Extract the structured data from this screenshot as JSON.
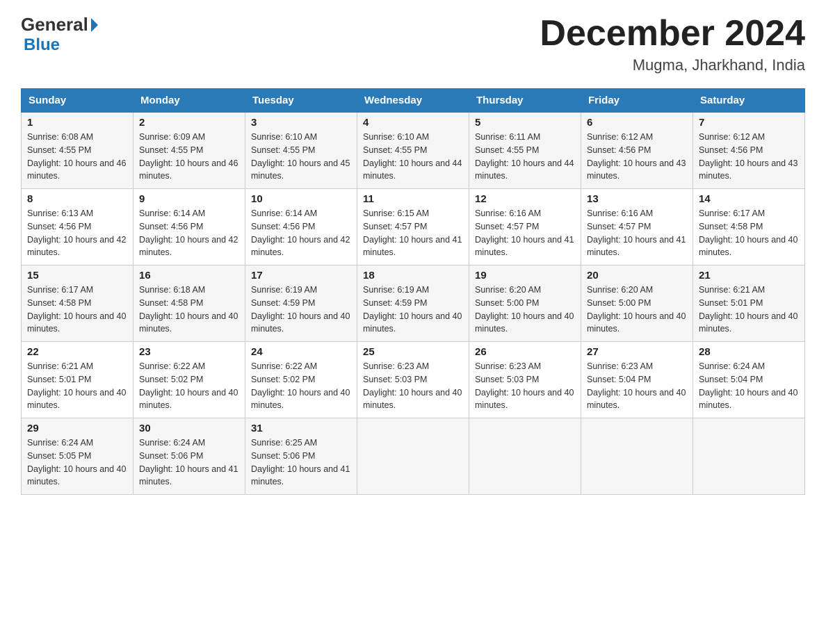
{
  "header": {
    "logo_general": "General",
    "logo_blue": "Blue",
    "month_title": "December 2024",
    "location": "Mugma, Jharkhand, India"
  },
  "days_of_week": [
    "Sunday",
    "Monday",
    "Tuesday",
    "Wednesday",
    "Thursday",
    "Friday",
    "Saturday"
  ],
  "weeks": [
    [
      {
        "day": "1",
        "sunrise": "6:08 AM",
        "sunset": "4:55 PM",
        "daylight": "10 hours and 46 minutes."
      },
      {
        "day": "2",
        "sunrise": "6:09 AM",
        "sunset": "4:55 PM",
        "daylight": "10 hours and 46 minutes."
      },
      {
        "day": "3",
        "sunrise": "6:10 AM",
        "sunset": "4:55 PM",
        "daylight": "10 hours and 45 minutes."
      },
      {
        "day": "4",
        "sunrise": "6:10 AM",
        "sunset": "4:55 PM",
        "daylight": "10 hours and 44 minutes."
      },
      {
        "day": "5",
        "sunrise": "6:11 AM",
        "sunset": "4:55 PM",
        "daylight": "10 hours and 44 minutes."
      },
      {
        "day": "6",
        "sunrise": "6:12 AM",
        "sunset": "4:56 PM",
        "daylight": "10 hours and 43 minutes."
      },
      {
        "day": "7",
        "sunrise": "6:12 AM",
        "sunset": "4:56 PM",
        "daylight": "10 hours and 43 minutes."
      }
    ],
    [
      {
        "day": "8",
        "sunrise": "6:13 AM",
        "sunset": "4:56 PM",
        "daylight": "10 hours and 42 minutes."
      },
      {
        "day": "9",
        "sunrise": "6:14 AM",
        "sunset": "4:56 PM",
        "daylight": "10 hours and 42 minutes."
      },
      {
        "day": "10",
        "sunrise": "6:14 AM",
        "sunset": "4:56 PM",
        "daylight": "10 hours and 42 minutes."
      },
      {
        "day": "11",
        "sunrise": "6:15 AM",
        "sunset": "4:57 PM",
        "daylight": "10 hours and 41 minutes."
      },
      {
        "day": "12",
        "sunrise": "6:16 AM",
        "sunset": "4:57 PM",
        "daylight": "10 hours and 41 minutes."
      },
      {
        "day": "13",
        "sunrise": "6:16 AM",
        "sunset": "4:57 PM",
        "daylight": "10 hours and 41 minutes."
      },
      {
        "day": "14",
        "sunrise": "6:17 AM",
        "sunset": "4:58 PM",
        "daylight": "10 hours and 40 minutes."
      }
    ],
    [
      {
        "day": "15",
        "sunrise": "6:17 AM",
        "sunset": "4:58 PM",
        "daylight": "10 hours and 40 minutes."
      },
      {
        "day": "16",
        "sunrise": "6:18 AM",
        "sunset": "4:58 PM",
        "daylight": "10 hours and 40 minutes."
      },
      {
        "day": "17",
        "sunrise": "6:19 AM",
        "sunset": "4:59 PM",
        "daylight": "10 hours and 40 minutes."
      },
      {
        "day": "18",
        "sunrise": "6:19 AM",
        "sunset": "4:59 PM",
        "daylight": "10 hours and 40 minutes."
      },
      {
        "day": "19",
        "sunrise": "6:20 AM",
        "sunset": "5:00 PM",
        "daylight": "10 hours and 40 minutes."
      },
      {
        "day": "20",
        "sunrise": "6:20 AM",
        "sunset": "5:00 PM",
        "daylight": "10 hours and 40 minutes."
      },
      {
        "day": "21",
        "sunrise": "6:21 AM",
        "sunset": "5:01 PM",
        "daylight": "10 hours and 40 minutes."
      }
    ],
    [
      {
        "day": "22",
        "sunrise": "6:21 AM",
        "sunset": "5:01 PM",
        "daylight": "10 hours and 40 minutes."
      },
      {
        "day": "23",
        "sunrise": "6:22 AM",
        "sunset": "5:02 PM",
        "daylight": "10 hours and 40 minutes."
      },
      {
        "day": "24",
        "sunrise": "6:22 AM",
        "sunset": "5:02 PM",
        "daylight": "10 hours and 40 minutes."
      },
      {
        "day": "25",
        "sunrise": "6:23 AM",
        "sunset": "5:03 PM",
        "daylight": "10 hours and 40 minutes."
      },
      {
        "day": "26",
        "sunrise": "6:23 AM",
        "sunset": "5:03 PM",
        "daylight": "10 hours and 40 minutes."
      },
      {
        "day": "27",
        "sunrise": "6:23 AM",
        "sunset": "5:04 PM",
        "daylight": "10 hours and 40 minutes."
      },
      {
        "day": "28",
        "sunrise": "6:24 AM",
        "sunset": "5:04 PM",
        "daylight": "10 hours and 40 minutes."
      }
    ],
    [
      {
        "day": "29",
        "sunrise": "6:24 AM",
        "sunset": "5:05 PM",
        "daylight": "10 hours and 40 minutes."
      },
      {
        "day": "30",
        "sunrise": "6:24 AM",
        "sunset": "5:06 PM",
        "daylight": "10 hours and 41 minutes."
      },
      {
        "day": "31",
        "sunrise": "6:25 AM",
        "sunset": "5:06 PM",
        "daylight": "10 hours and 41 minutes."
      },
      null,
      null,
      null,
      null
    ]
  ],
  "labels": {
    "sunrise": "Sunrise:",
    "sunset": "Sunset:",
    "daylight": "Daylight:"
  }
}
